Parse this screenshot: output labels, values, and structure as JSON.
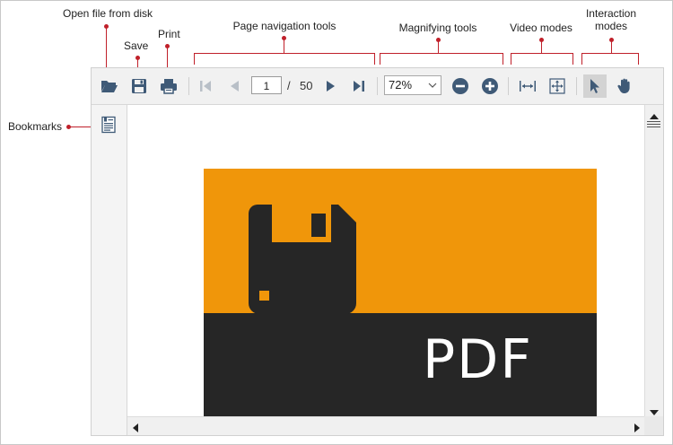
{
  "annotations": {
    "open_file": "Open file from disk",
    "save": "Save",
    "print": "Print",
    "page_navigation": "Page navigation tools",
    "magnifying": "Magnifying tools",
    "video_modes": "Video modes",
    "interaction_modes_line1": "Interaction",
    "interaction_modes_line2": "modes",
    "bookmarks": "Bookmarks"
  },
  "toolbar": {
    "current_page": "1",
    "page_separator": "/",
    "total_pages": "50",
    "zoom_value": "72%"
  },
  "document": {
    "page_text": "PDF"
  },
  "colors": {
    "accent": "#c0202a",
    "pdf_orange": "#f0960a",
    "pdf_dark": "#262626",
    "icon_blue": "#3f5a77"
  }
}
